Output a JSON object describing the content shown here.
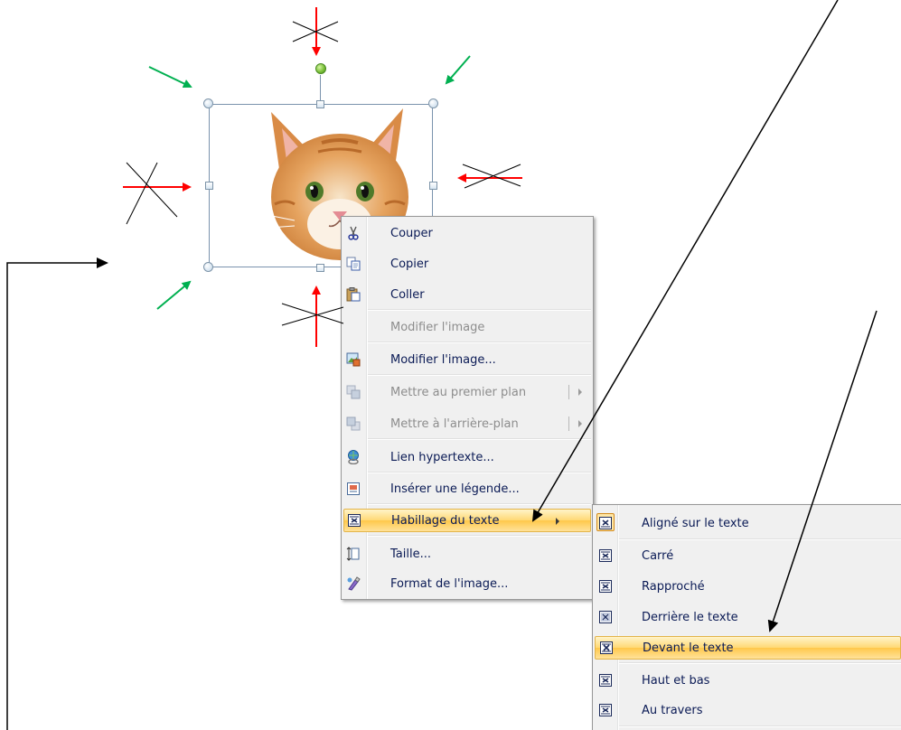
{
  "context_menu": {
    "items": [
      {
        "label": "Couper",
        "icon": "scissors-icon"
      },
      {
        "label": "Copier",
        "icon": "copy-icon"
      },
      {
        "label": "Coller",
        "icon": "paste-icon"
      },
      {
        "label": "Modifier l'image",
        "icon": "none",
        "disabled": true
      },
      {
        "label": "Modifier l'image...",
        "icon": "change-picture-icon"
      },
      {
        "label": "Mettre au premier plan",
        "icon": "bring-forward-icon",
        "disabled": true
      },
      {
        "label": "Mettre à l'arrière-plan",
        "icon": "send-backward-icon",
        "disabled": true
      },
      {
        "label": "Lien hypertexte...",
        "icon": "hyperlink-icon"
      },
      {
        "label": "Insérer une légende...",
        "icon": "caption-icon"
      },
      {
        "label": "Habillage du texte",
        "icon": "text-wrap-icon",
        "highlighted": true
      },
      {
        "label": "Taille...",
        "icon": "size-icon"
      },
      {
        "label": "Format de l'image...",
        "icon": "format-picture-icon"
      }
    ]
  },
  "wrap_submenu": {
    "items": [
      {
        "label": "Aligné sur le texte",
        "icon": "inline-with-text-icon"
      },
      {
        "label": "Carré",
        "icon": "square-wrap-icon"
      },
      {
        "label": "Rapproché",
        "icon": "tight-wrap-icon"
      },
      {
        "label": "Derrière le texte",
        "icon": "behind-text-icon"
      },
      {
        "label": "Devant le texte",
        "icon": "in-front-of-text-icon",
        "highlighted": true
      },
      {
        "label": "Haut et bas",
        "icon": "top-bottom-wrap-icon"
      },
      {
        "label": "Au travers",
        "icon": "through-wrap-icon"
      }
    ]
  },
  "colors": {
    "red_arrow": "#ff0000",
    "green_arrow": "#00b050",
    "menu_highlight": "#ffd974"
  }
}
